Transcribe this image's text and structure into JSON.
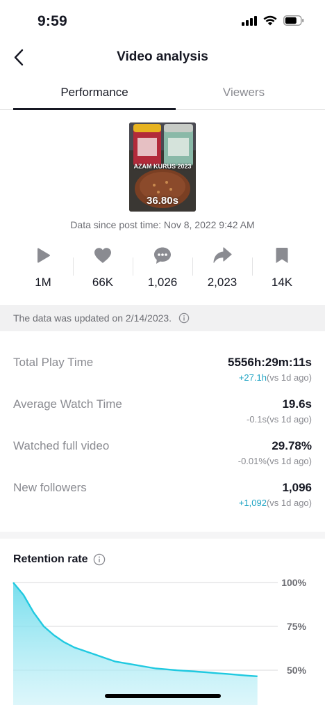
{
  "status_bar": {
    "time": "9:59"
  },
  "nav": {
    "title": "Video analysis"
  },
  "tabs": [
    {
      "label": "Performance",
      "active": true
    },
    {
      "label": "Viewers",
      "active": false
    }
  ],
  "video": {
    "caption": "AZAM KURUS 2023",
    "duration": "36.80s",
    "post_time": "Data since post time: Nov 8, 2022 9:42 AM"
  },
  "stats": [
    {
      "icon": "play-icon",
      "value": "1M"
    },
    {
      "icon": "heart-icon",
      "value": "66K"
    },
    {
      "icon": "comment-icon",
      "value": "1,026"
    },
    {
      "icon": "share-icon",
      "value": "2,023"
    },
    {
      "icon": "bookmark-icon",
      "value": "14K"
    }
  ],
  "update_notice": "The data was updated on 2/14/2023.",
  "metrics": [
    {
      "label": "Total Play Time",
      "value": "5556h:29m:11s",
      "change": "+27.1h",
      "compare": "(vs 1d ago)",
      "positive": true
    },
    {
      "label": "Average Watch Time",
      "value": "19.6s",
      "change": "-0.1s",
      "compare": "(vs 1d ago)",
      "positive": false
    },
    {
      "label": "Watched full video",
      "value": "29.78%",
      "change": "-0.01%",
      "compare": "(vs 1d ago)",
      "positive": false
    },
    {
      "label": "New followers",
      "value": "1,096",
      "change": "+1,092",
      "compare": "(vs 1d ago)",
      "positive": true
    }
  ],
  "retention": {
    "title": "Retention rate"
  },
  "colors": {
    "accent": "#20a4c4",
    "retention_line": "#20c9e0",
    "text_primary": "#161823",
    "text_secondary": "#8a8b91"
  },
  "chart_data": {
    "type": "area",
    "title": "Retention rate",
    "y_ticks": [
      "100%",
      "75%",
      "50%"
    ],
    "ylim": [
      40,
      100
    ],
    "xlim": [
      0,
      36.8
    ],
    "grid": true,
    "x": [
      0,
      1,
      2,
      3,
      4,
      5,
      6,
      7,
      8,
      9,
      10,
      11,
      12,
      13,
      14,
      15,
      16,
      17,
      18,
      19,
      20,
      21,
      22,
      23,
      24
    ],
    "series": [
      {
        "values": [
          100,
          93,
          83,
          75,
          70,
          66,
          63,
          61,
          59,
          57,
          55,
          54,
          53,
          52,
          51,
          50.5,
          50,
          49.6,
          49.2,
          48.8,
          48.3,
          47.9,
          47.4,
          46.9,
          46.5
        ]
      }
    ]
  }
}
